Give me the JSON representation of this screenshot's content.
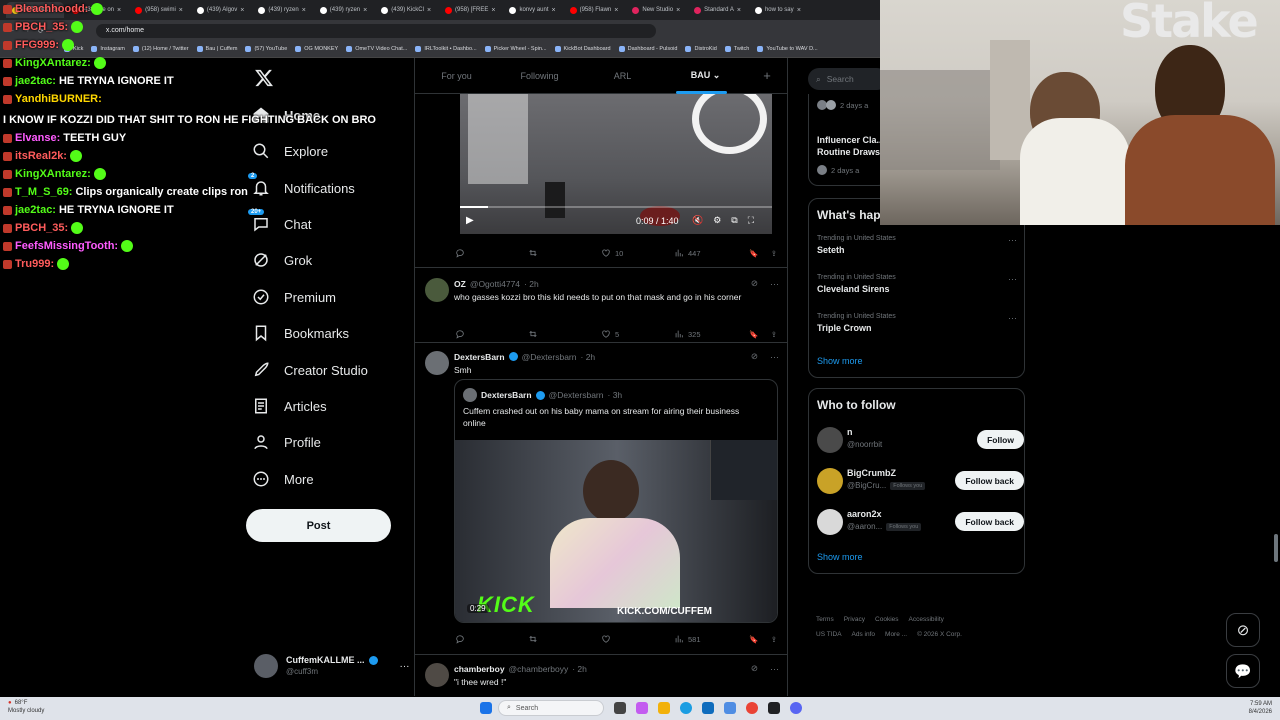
{
  "browser": {
    "tabs": [
      {
        "label": "IRLToolkit",
        "color": "#f0c419"
      },
      {
        "label": "(438) jae on",
        "color": "#ff0000"
      },
      {
        "label": "(958) swimi",
        "color": "#ff0000"
      },
      {
        "label": "(439) Algov",
        "color": "#ffffff"
      },
      {
        "label": "(439) ryzen",
        "color": "#ffffff"
      },
      {
        "label": "(439) ryzen",
        "color": "#ffffff"
      },
      {
        "label": "(439) KickCl",
        "color": "#ffffff"
      },
      {
        "label": "(958) [FREE",
        "color": "#ff0000"
      },
      {
        "label": "konvy aunt",
        "color": "#ffffff"
      },
      {
        "label": "(958) Flawn",
        "color": "#ff0000"
      },
      {
        "label": "New Studio",
        "color": "#e0245e"
      },
      {
        "label": "Standard A",
        "color": "#e0245e"
      },
      {
        "label": "how to say",
        "color": "#ffffff"
      }
    ],
    "url": "x.com/home",
    "bookmarks": [
      "Kick",
      "Instagram",
      "(12) Home / Twitter",
      "Bau | Cuffem",
      "(57) YouTube",
      "OG MONKEY",
      "OmeTV Video Chat...",
      "IRLToolkit • Dashbo...",
      "Picker Wheel - Spin...",
      "KickBot Dashboard",
      "Dashboard - Pulsoid",
      "DistroKid",
      "Twitch",
      "YouTube to WAV D..."
    ]
  },
  "chat": [
    {
      "user": "Bleachhoodd:",
      "color": "#ff5c5c",
      "msg": ""
    },
    {
      "user": "PBCH_35:",
      "color": "#ff5c5c",
      "msg": ""
    },
    {
      "user": "FFG999:",
      "color": "#ff5c5c",
      "msg": ""
    },
    {
      "user": "KingXAntarez:",
      "color": "#53fc18",
      "msg": ""
    },
    {
      "user": "jae2tac:",
      "color": "#53fc18",
      "msg": "HE TRYNA IGNORE IT"
    },
    {
      "user": "YandhiBURNER:",
      "color": "#ffd700",
      "msg": "I KNOW IF KOZZI DID THAT SHIT TO RON HE FIGHTING BACK ON BRO"
    },
    {
      "user": "Elvanse:",
      "color": "#ff5cff",
      "msg": "TEETH GUY"
    },
    {
      "user": "itsReal2k:",
      "color": "#ff5c5c",
      "msg": ""
    },
    {
      "user": "KingXAntarez:",
      "color": "#53fc18",
      "msg": ""
    },
    {
      "user": "T_M_S_69:",
      "color": "#53fc18",
      "msg": "Clips organically create clips ron"
    },
    {
      "user": "jae2tac:",
      "color": "#53fc18",
      "msg": "HE TRYNA IGNORE IT"
    },
    {
      "user": "PBCH_35:",
      "color": "#ff5c5c",
      "msg": ""
    },
    {
      "user": "FeefsMissingTooth:",
      "color": "#ff5cff",
      "msg": ""
    },
    {
      "user": "Tru999:",
      "color": "#ff5c5c",
      "msg": ""
    }
  ],
  "nav": {
    "items": [
      {
        "label": "Home",
        "icon": "home-icon"
      },
      {
        "label": "Explore",
        "icon": "search-icon"
      },
      {
        "label": "Notifications",
        "icon": "bell-icon",
        "badge": "2"
      },
      {
        "label": "Chat",
        "icon": "chat-icon",
        "badge": "20+"
      },
      {
        "label": "Grok",
        "icon": "grok-icon"
      },
      {
        "label": "Premium",
        "icon": "premium-icon"
      },
      {
        "label": "Bookmarks",
        "icon": "bookmark-icon"
      },
      {
        "label": "Creator Studio",
        "icon": "rocket-icon"
      },
      {
        "label": "Articles",
        "icon": "articles-icon"
      },
      {
        "label": "Profile",
        "icon": "profile-icon"
      },
      {
        "label": "More",
        "icon": "more-icon"
      }
    ],
    "post_label": "Post",
    "account": {
      "name": "CuffemKALLME ...",
      "handle": "@cuff3m"
    }
  },
  "feed": {
    "tabs": [
      "For you",
      "Following",
      "ARL",
      "BAU"
    ],
    "video1": {
      "time": "0:09 / 1:40",
      "replies": "",
      "retweets": "",
      "likes": "10",
      "views": "447",
      "progress": 0.09
    },
    "tweet1": {
      "name": "OZ",
      "handle": "@Ogotti4774",
      "time": "· 2h",
      "text": "who gasses kozzi bro this kid needs to put on that mask and go in his corner",
      "likes": "5",
      "views": "325"
    },
    "tweet2": {
      "name": "DextersBarn",
      "handle": "@Dextersbarn",
      "time": "· 2h",
      "text": "Smh",
      "quote": {
        "name": "DextersBarn",
        "handle": "@Dextersbarn",
        "time": "· 3h",
        "text": "Cuffem crashed out on his baby mama on stream for airing their business online",
        "video_time": "0:29",
        "overlay_kick": "KICK",
        "overlay_url": "KICK.COM/CUFFEM"
      },
      "views": "581"
    },
    "tweet3": {
      "name": "chamberboy",
      "handle": "@chamberboyy",
      "time": "· 2h",
      "text": "\"i thee wred !\""
    }
  },
  "right": {
    "search_placeholder": "Search",
    "top_time": "2 days a",
    "top_title": "Influencer Cla... Routine Draws",
    "top_time2": "2 days a",
    "whats_happening": "What's hap",
    "trends": [
      {
        "label": "Trending in United States",
        "name": "Seteth"
      },
      {
        "label": "Trending in United States",
        "name": "Cleveland Sirens"
      },
      {
        "label": "Trending in United States",
        "name": "Triple Crown"
      }
    ],
    "show_more": "Show more",
    "who_to_follow": "Who to follow",
    "follows": [
      {
        "name": "n",
        "handle": "@noorrbit",
        "tag": "",
        "button": "Follow"
      },
      {
        "name": "BigCrumbZ",
        "handle": "@BigCru...",
        "tag": "Follows you",
        "button": "Follow back"
      },
      {
        "name": "aaron2x",
        "handle": "@aaron...",
        "tag": "Follows you",
        "button": "Follow back"
      }
    ],
    "show_more2": "Show more",
    "footer": [
      "Terms",
      "Privacy",
      "Cookies",
      "Accessibility",
      "US TIDA",
      "Ads info",
      "More ...",
      "© 2026 X Corp."
    ]
  },
  "taskbar": {
    "weather_temp": "68°F",
    "weather_text": "Mostly cloudy",
    "search": "Search",
    "time": "7:59 AM",
    "date": "8/4/2026"
  },
  "cam": {
    "logo": "Stake"
  }
}
